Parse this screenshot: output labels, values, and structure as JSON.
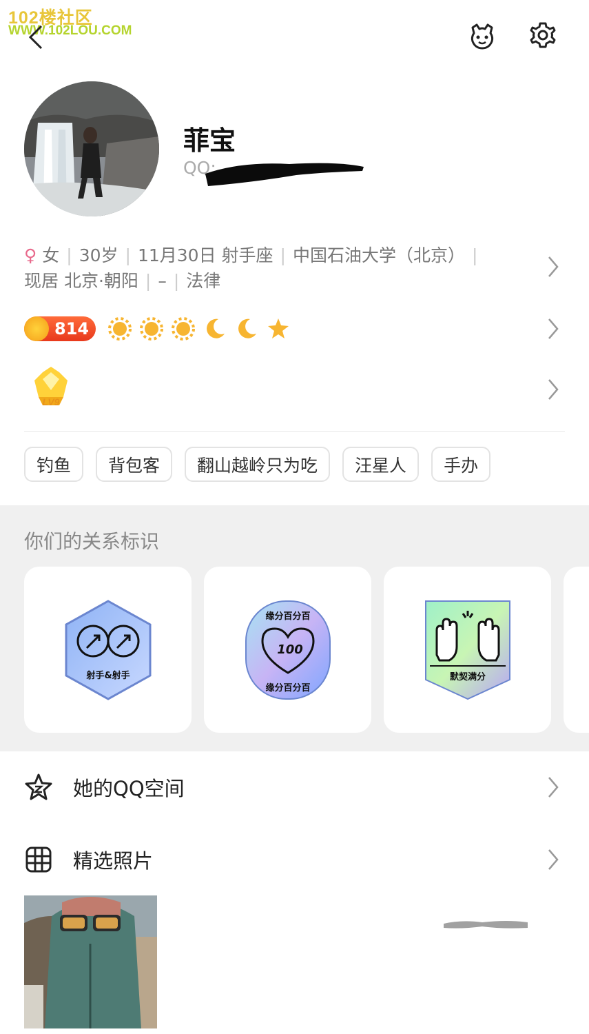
{
  "watermark": {
    "line1": "102楼社区",
    "line2": "WWW.102LOU.COM"
  },
  "header": {
    "back_icon": "chevron-left-icon",
    "pet_icon": "pet-face-icon",
    "settings_icon": "gear-icon"
  },
  "profile": {
    "name": "菲宝",
    "qq_label": "QQ:"
  },
  "info": {
    "gender_symbol": "♀",
    "gender": "女",
    "age": "30岁",
    "birthday": "11月30日 射手座",
    "school": "中国石油大学（北京）",
    "residence": "现居 北京·朝阳",
    "dash": "–",
    "occupation": "法律"
  },
  "level": {
    "coin_value": "814",
    "badges": [
      "sun",
      "sun",
      "sun",
      "moon",
      "moon",
      "star"
    ]
  },
  "vip": {
    "level_text": "LV9"
  },
  "tags": [
    "钓鱼",
    "背包客",
    "翻山越岭只为吃",
    "汪星人",
    "手办"
  ],
  "relation": {
    "title": "你们的关系标识",
    "cards": [
      {
        "label": "射手&射手"
      },
      {
        "label_top": "缘分百分百",
        "label_bottom": "缘分百分百",
        "number": "100"
      },
      {
        "label": "默契满分"
      }
    ]
  },
  "menu": {
    "qzone": "她的QQ空间",
    "photos": "精选照片"
  },
  "colors": {
    "accent_coin": "#e8391c",
    "gender": "#e86a8c",
    "gray_bg": "#f0f0f0"
  }
}
